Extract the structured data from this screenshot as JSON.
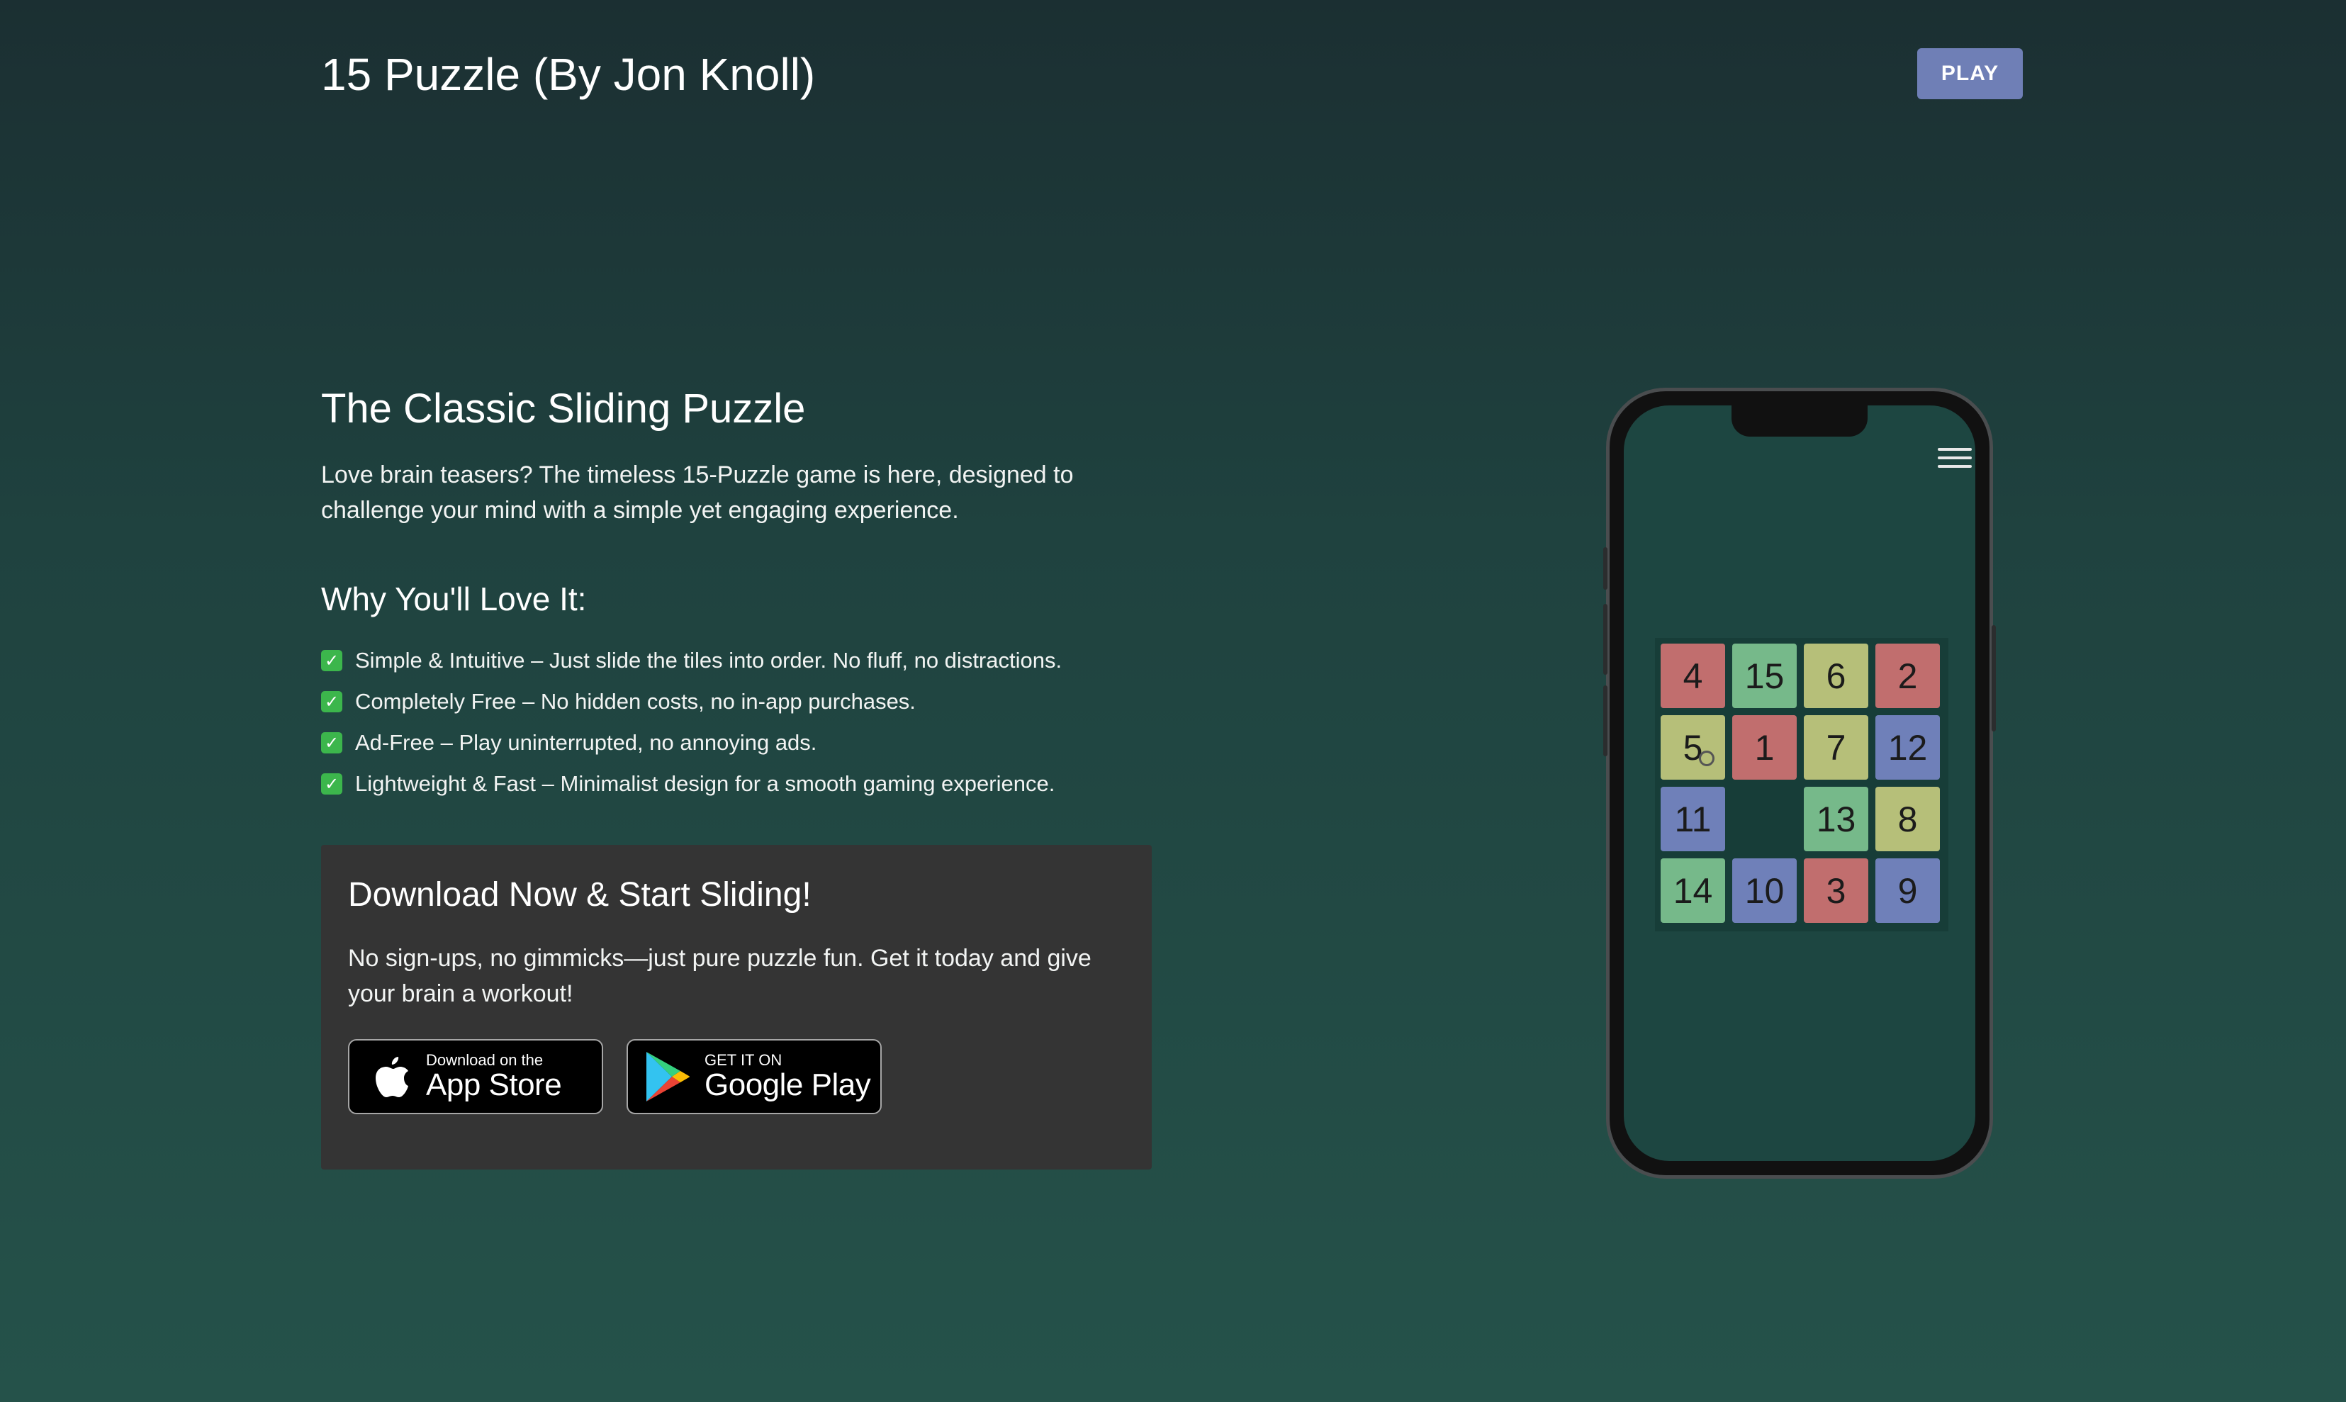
{
  "header": {
    "title": "15 Puzzle (By Jon Knoll)",
    "play_label": "PLAY"
  },
  "hero": {
    "title": "The Classic Sliding Puzzle",
    "intro": "Love brain teasers? The timeless 15-Puzzle game is here, designed to challenge your mind with a simple yet engaging experience."
  },
  "why": {
    "title": "Why You'll Love It:",
    "features": [
      "Simple & Intuitive – Just slide the tiles into order. No fluff, no distractions.",
      "Completely Free – No hidden costs, no in-app purchases.",
      "Ad-Free – Play uninterrupted, no annoying ads.",
      "Lightweight & Fast – Minimalist design for a smooth gaming experience."
    ]
  },
  "download": {
    "title": "Download Now & Start Sliding!",
    "text": "No sign-ups, no gimmicks—just pure puzzle fun. Get it today and give your brain a workout!",
    "appstore": {
      "small": "Download on the",
      "big": "App Store"
    },
    "googleplay": {
      "small": "GET IT ON",
      "big": "Google Play"
    }
  },
  "phone": {
    "board": [
      [
        4,
        15,
        6,
        2
      ],
      [
        5,
        1,
        7,
        12
      ],
      [
        11,
        null,
        13,
        8
      ],
      [
        14,
        10,
        3,
        9
      ]
    ],
    "tile_colors": {
      "red": "#c16e6e",
      "green": "#76b98a",
      "yellow": "#b6bf79",
      "blue": "#6f80b9"
    },
    "tile_color_map": {
      "4": "red",
      "15": "green",
      "6": "yellow",
      "2": "red",
      "5": "yellow",
      "1": "red",
      "7": "yellow",
      "12": "blue",
      "11": "blue",
      "13": "green",
      "8": "yellow",
      "14": "green",
      "10": "blue",
      "3": "red",
      "9": "blue"
    }
  },
  "colors": {
    "accent": "#6f7fb6",
    "panel": "#343434",
    "check": "#3cb64c"
  }
}
